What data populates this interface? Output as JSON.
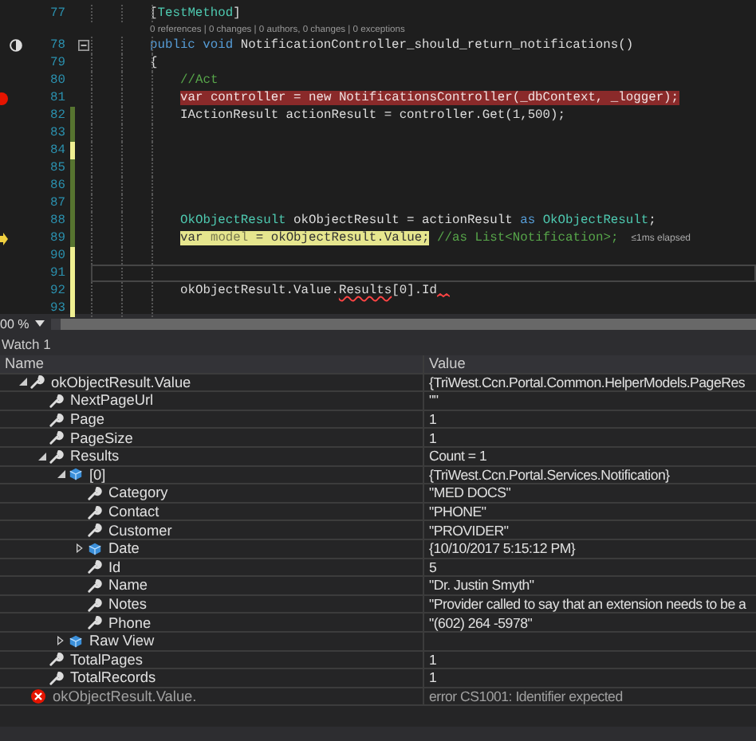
{
  "editor": {
    "lines": [
      {
        "number": "77",
        "kind": "member",
        "tokens": [
          {
            "t": "[",
            "kind": "plain"
          },
          {
            "t": "TestMethod",
            "kind": "type"
          },
          {
            "t": "]",
            "kind": "plain"
          }
        ]
      },
      {
        "number": "78",
        "kind": "member",
        "lens": "0 references | 0 changes | 0 authors, 0 changes | 0 exceptions",
        "collapsible": true,
        "test_status": true,
        "tokens": [
          {
            "t": "public void",
            "kind": "keyword"
          },
          {
            "t": " NotificationController_should_return_notifications()",
            "kind": "plain"
          }
        ]
      },
      {
        "number": "79",
        "kind": "member",
        "tokens": [
          {
            "t": "{",
            "kind": "plain"
          }
        ]
      },
      {
        "number": "80",
        "kind": "statement",
        "tokens": [
          {
            "t": "//Act",
            "kind": "comment"
          }
        ]
      },
      {
        "number": "81",
        "kind": "statement",
        "breakpoint": true,
        "tokens": [
          {
            "t": "var controller = new NotificationsController(_dbContext, _logger);",
            "kind": "plain"
          }
        ]
      },
      {
        "number": "82",
        "kind": "statement",
        "saved": true,
        "tokens": [
          {
            "t": "IActionResult actionResult = controller.Get(1,500);",
            "kind": "plain"
          }
        ]
      },
      {
        "number": "83",
        "kind": "statement",
        "saved": true
      },
      {
        "number": "84",
        "kind": "statement",
        "saved": false
      },
      {
        "number": "85",
        "kind": "statement",
        "saved": true
      },
      {
        "number": "86",
        "kind": "statement",
        "saved": true
      },
      {
        "number": "87",
        "kind": "statement",
        "saved": true
      },
      {
        "number": "88",
        "kind": "statement",
        "saved": true,
        "tokens": [
          {
            "t": "OkObjectResult",
            "kind": "type"
          },
          {
            "t": " okObjectResult = actionResult ",
            "kind": "plain"
          },
          {
            "t": "as",
            "kind": "keyword"
          },
          {
            "t": " OkObjectResult",
            "kind": "type"
          },
          {
            "t": ";",
            "kind": "plain"
          }
        ]
      },
      {
        "number": "89",
        "kind": "statement",
        "saved": true,
        "current": true,
        "hint": "≤1ms elapsed",
        "tokens": [
          {
            "t": "var",
            "kind": "keyword"
          },
          {
            "t": " model",
            "kind": "unused"
          },
          {
            "t": " = okObjectResult.Value;",
            "kind": "plain"
          },
          {
            "t": " //as List<Notification>;",
            "kind": "comment"
          }
        ]
      },
      {
        "number": "90",
        "kind": "statement",
        "saved": false
      },
      {
        "number": "91",
        "kind": "statement",
        "saved": false,
        "caret_line": true
      },
      {
        "number": "92",
        "kind": "statement",
        "saved": false,
        "trailing_error": true,
        "tokens": [
          {
            "t": "okObjectResult.Value.",
            "kind": "plain"
          },
          {
            "t": "Results",
            "kind": "error"
          },
          {
            "t": "[0].Id",
            "kind": "plain"
          }
        ]
      },
      {
        "number": "93",
        "kind": "statement",
        "saved": false
      }
    ]
  },
  "zoom": {
    "value": "00 %"
  },
  "watch": {
    "title": "Watch 1",
    "columns": [
      "Name",
      "Value"
    ],
    "rows": [
      {
        "name": "okObjectResult.Value",
        "value": "{TriWest.Ccn.Portal.Common.HelperModels.PageRes",
        "kind": "property",
        "expanded": true,
        "children": [
          {
            "name": "NextPageUrl",
            "value": "\"\"",
            "kind": "property"
          },
          {
            "name": "Page",
            "value": "1",
            "kind": "property"
          },
          {
            "name": "PageSize",
            "value": "1",
            "kind": "property"
          },
          {
            "name": "Results",
            "value": "Count = 1",
            "kind": "property",
            "expanded": true,
            "children": [
              {
                "name": "[0]",
                "value": "{TriWest.Ccn.Portal.Services.Notification}",
                "kind": "object",
                "expanded": true,
                "children": [
                  {
                    "name": "Category",
                    "value": "\"MED DOCS\"",
                    "kind": "property"
                  },
                  {
                    "name": "Contact",
                    "value": "\"PHONE\"",
                    "kind": "property"
                  },
                  {
                    "name": "Customer",
                    "value": "\"PROVIDER\"",
                    "kind": "property"
                  },
                  {
                    "name": "Date",
                    "value": "{10/10/2017 5:15:12 PM}",
                    "kind": "object",
                    "expanded": false
                  },
                  {
                    "name": "Id",
                    "value": "5",
                    "kind": "property"
                  },
                  {
                    "name": "Name",
                    "value": "\"Dr. Justin Smyth\"",
                    "kind": "property"
                  },
                  {
                    "name": "Notes",
                    "value": "\"Provider called to say that an extension needs to be a",
                    "kind": "property"
                  },
                  {
                    "name": "Phone",
                    "value": "\"(602) 264 -5978\"",
                    "kind": "property"
                  }
                ]
              },
              {
                "name": "Raw View",
                "kind": "object",
                "expanded": false
              }
            ]
          },
          {
            "name": "TotalPages",
            "value": "1",
            "kind": "property"
          },
          {
            "name": "TotalRecords",
            "value": "1",
            "kind": "property"
          }
        ]
      },
      {
        "name": "okObjectResult.Value.",
        "value": "error CS1001: Identifier expected",
        "kind": "error"
      }
    ]
  }
}
